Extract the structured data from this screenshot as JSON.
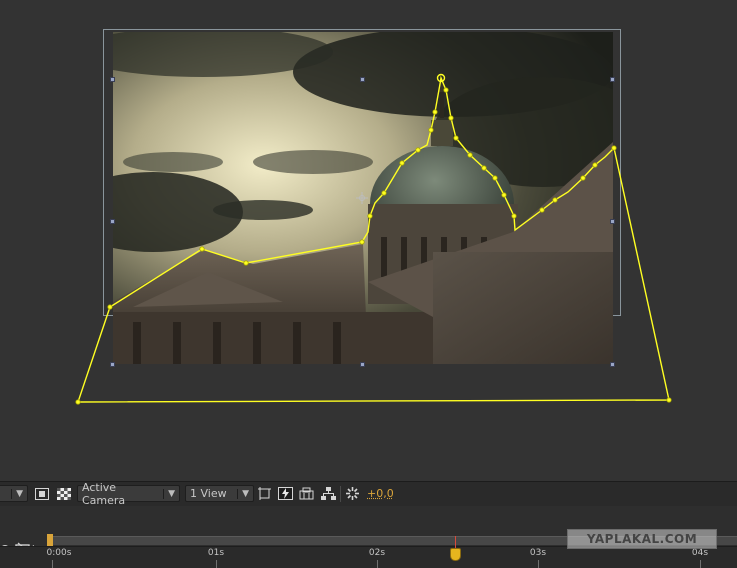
{
  "viewer_toolbar": {
    "view_dropdown": "Active Camera",
    "views_dropdown": "1 View",
    "exposure": "+0,0",
    "icons": [
      "mask-toggle-icon",
      "transparency-grid-icon",
      "region-of-interest-icon",
      "fast-previews-icon",
      "pixel-aspect-icon",
      "flowchart-icon",
      "exposure-reset-icon"
    ]
  },
  "timeline": {
    "ruler_ticks": [
      {
        "label": "0:00s",
        "time": 0
      },
      {
        "label": "01s",
        "time": 1
      },
      {
        "label": "02s",
        "time": 2
      },
      {
        "label": "03s",
        "time": 3
      },
      {
        "label": "04s",
        "time": 4
      }
    ],
    "current_time_fraction_of_04s": 0.62
  },
  "watermark": "YAPLAKAL.COM",
  "colors": {
    "panel_bg": "#333333",
    "mask_path": "#ffff22",
    "playhead": "#e6b51e",
    "playhead_line": "#d84b3b",
    "accent_value": "#d9a43a"
  }
}
